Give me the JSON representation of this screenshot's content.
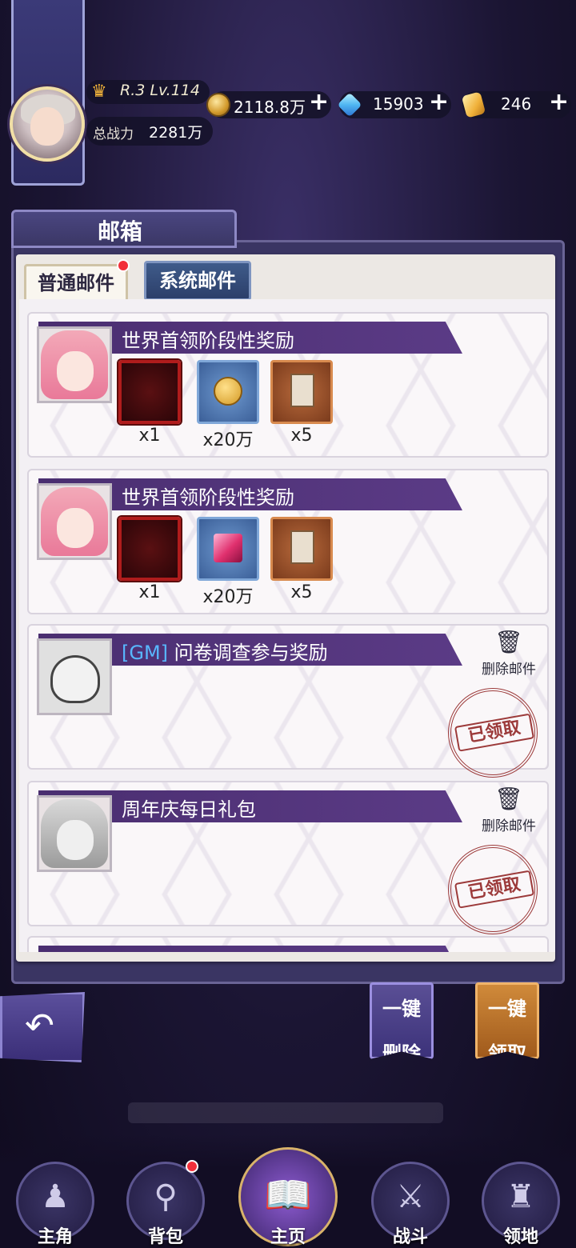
{
  "profile": {
    "level_text": "R.3 Lv.114",
    "power_label": "总战力",
    "power_value": "2281万",
    "rank_icon": "crown-icon"
  },
  "currencies": [
    {
      "icon": "coin-icon",
      "value": "2118.8万"
    },
    {
      "icon": "diamond-icon",
      "value": "15903"
    },
    {
      "icon": "gold-crystal-icon",
      "value": "246"
    }
  ],
  "plus_symbol": "+",
  "mailbox": {
    "title": "邮箱",
    "tabs": [
      {
        "label": "普通邮件",
        "active": true,
        "has_dot": true
      },
      {
        "label": "系统邮件",
        "active": false,
        "has_dot": false
      }
    ]
  },
  "mails": [
    {
      "title": "世界首领阶段性奖励",
      "items": [
        {
          "icon": "frame-icon",
          "qty": "x1"
        },
        {
          "icon": "medal-icon",
          "qty": "x20万"
        },
        {
          "icon": "card-icon",
          "qty": "x5"
        }
      ]
    },
    {
      "title": "世界首领阶段性奖励",
      "items": [
        {
          "icon": "frame-icon",
          "qty": "x1"
        },
        {
          "icon": "ruby-icon",
          "qty": "x20万"
        },
        {
          "icon": "card-icon",
          "qty": "x5"
        }
      ]
    },
    {
      "gm": "[GM]",
      "title": "问卷调查参与奖励",
      "delete_label": "删除邮件",
      "stamp": "已领取"
    },
    {
      "title": "周年庆每日礼包",
      "delete_label": "删除邮件",
      "stamp": "已领取"
    }
  ],
  "buttons": {
    "delete_all_line1": "一键",
    "delete_all_line2": "删除",
    "claim_all_line1": "一键",
    "claim_all_line2": "领取",
    "back_icon": "back-arrow-icon"
  },
  "nav": [
    {
      "label": "主角",
      "icon": "hero-icon"
    },
    {
      "label": "背包",
      "icon": "bag-icon",
      "has_dot": true
    },
    {
      "label": "主页",
      "icon": "book-icon"
    },
    {
      "label": "战斗",
      "icon": "swords-icon"
    },
    {
      "label": "领地",
      "icon": "castle-icon"
    }
  ]
}
